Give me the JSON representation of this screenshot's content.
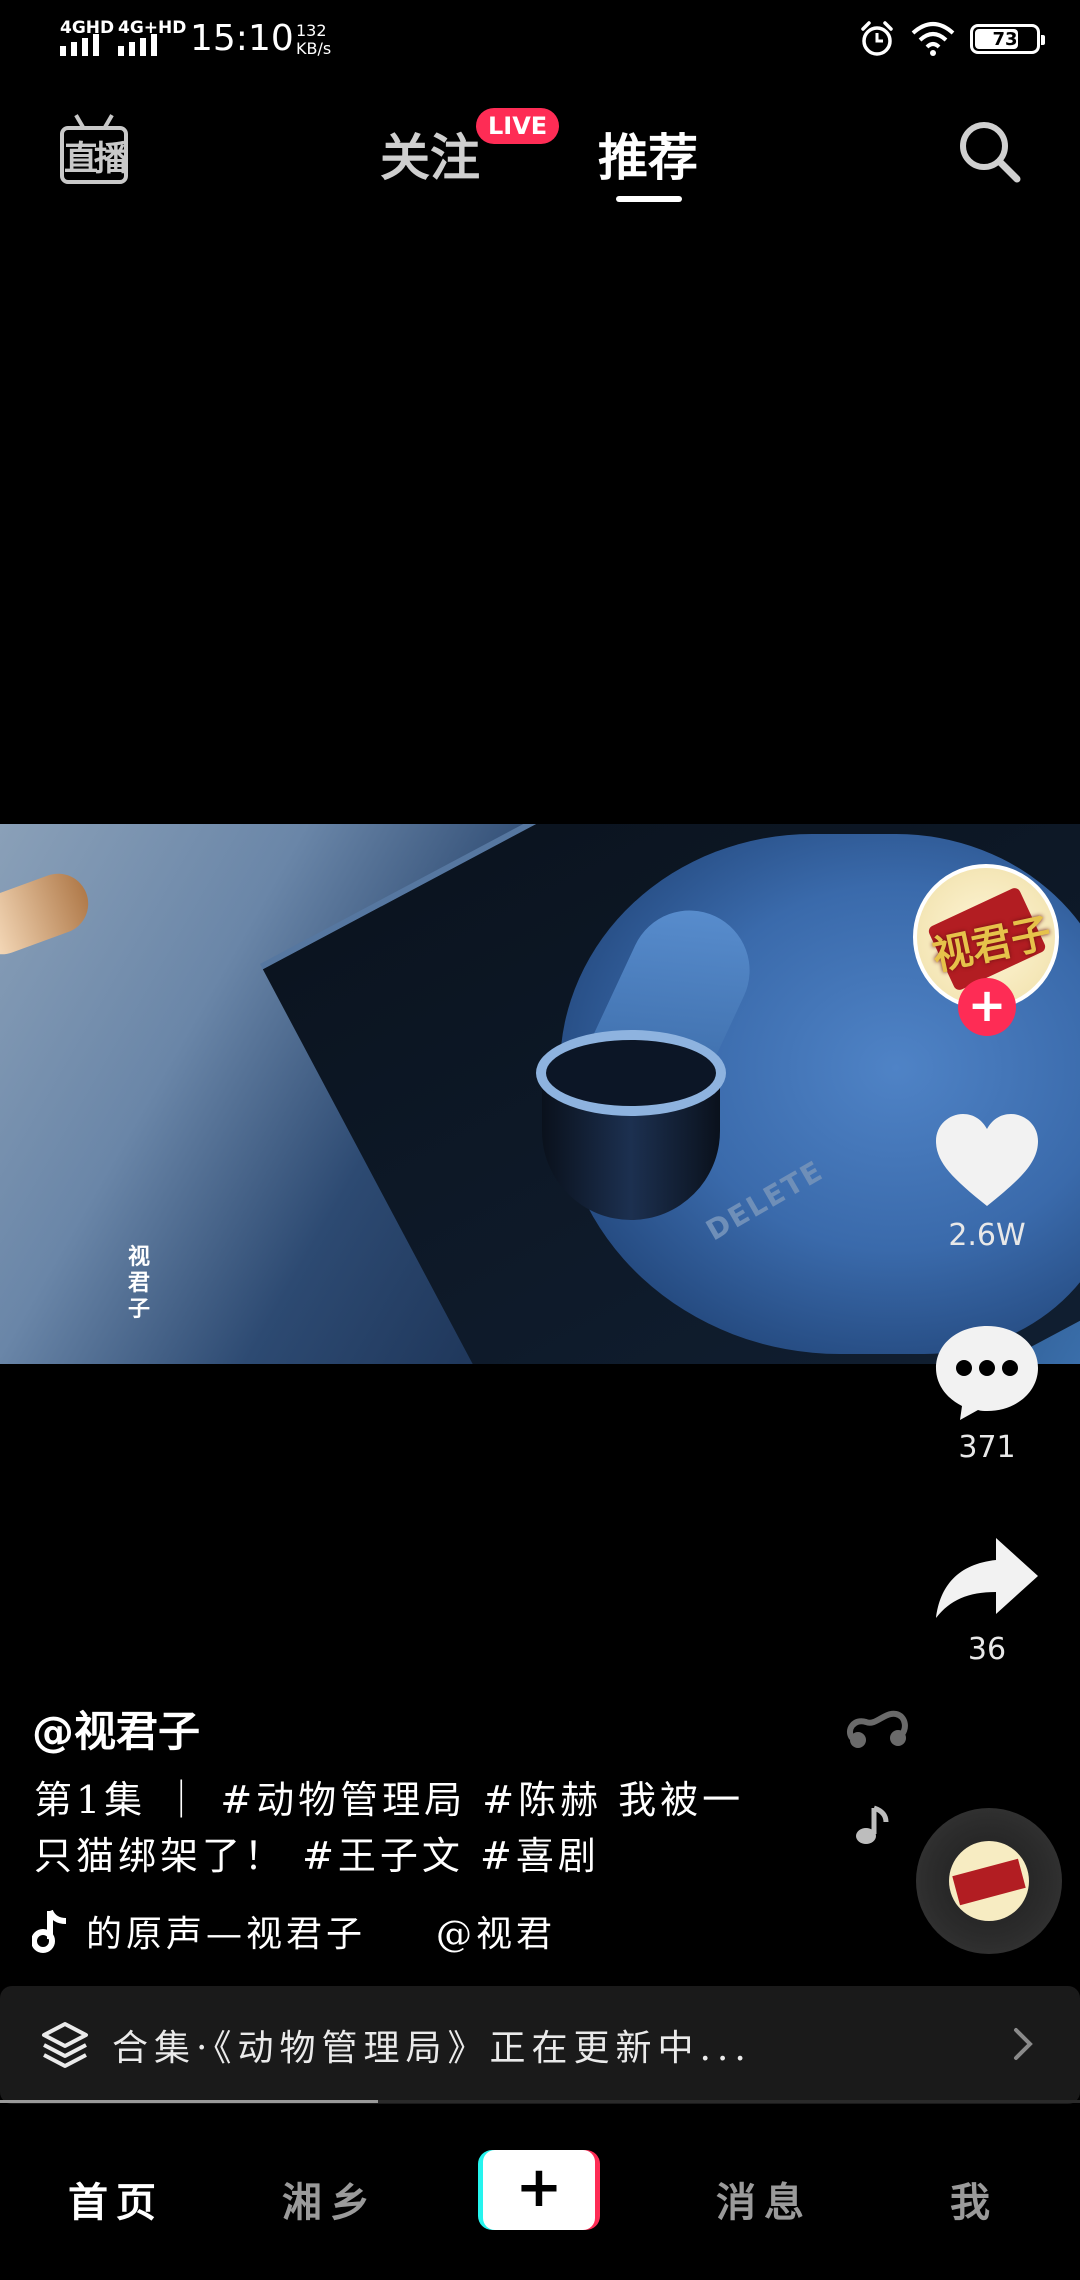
{
  "status_bar": {
    "network_1": "4GHD",
    "network_2": "4G+HD",
    "time": "15:10",
    "speed_value": "132",
    "speed_unit": "KB/s",
    "battery": "73",
    "battery_level_percent": 73
  },
  "top_nav": {
    "live_entry": "直播",
    "tab_follow": "关注",
    "live_badge": "LIVE",
    "tab_recommend": "推荐"
  },
  "video": {
    "watermark": "视君子",
    "panel_text": "DELETE"
  },
  "rail": {
    "avatar_text": "视君子",
    "like_count": "2.6W",
    "comment_count": "371",
    "share_count": "36"
  },
  "caption": {
    "author": "@视君子",
    "description": "第1集 ｜ #动物管理局  #陈赫 我被一只猫绑架了！ #王子文 #喜剧",
    "music": "的原声—视君子",
    "mention": "@视君"
  },
  "collection": {
    "text": "合集·《动物管理局》正在更新中..."
  },
  "playback_progress_fraction": 0.35,
  "bottom_nav": {
    "home": "首页",
    "local": "湘乡",
    "create": "+",
    "messages": "消息",
    "me": "我"
  },
  "colors": {
    "accent_red": "#fe2c55",
    "accent_cyan": "#25f4ee",
    "background": "#000000"
  }
}
